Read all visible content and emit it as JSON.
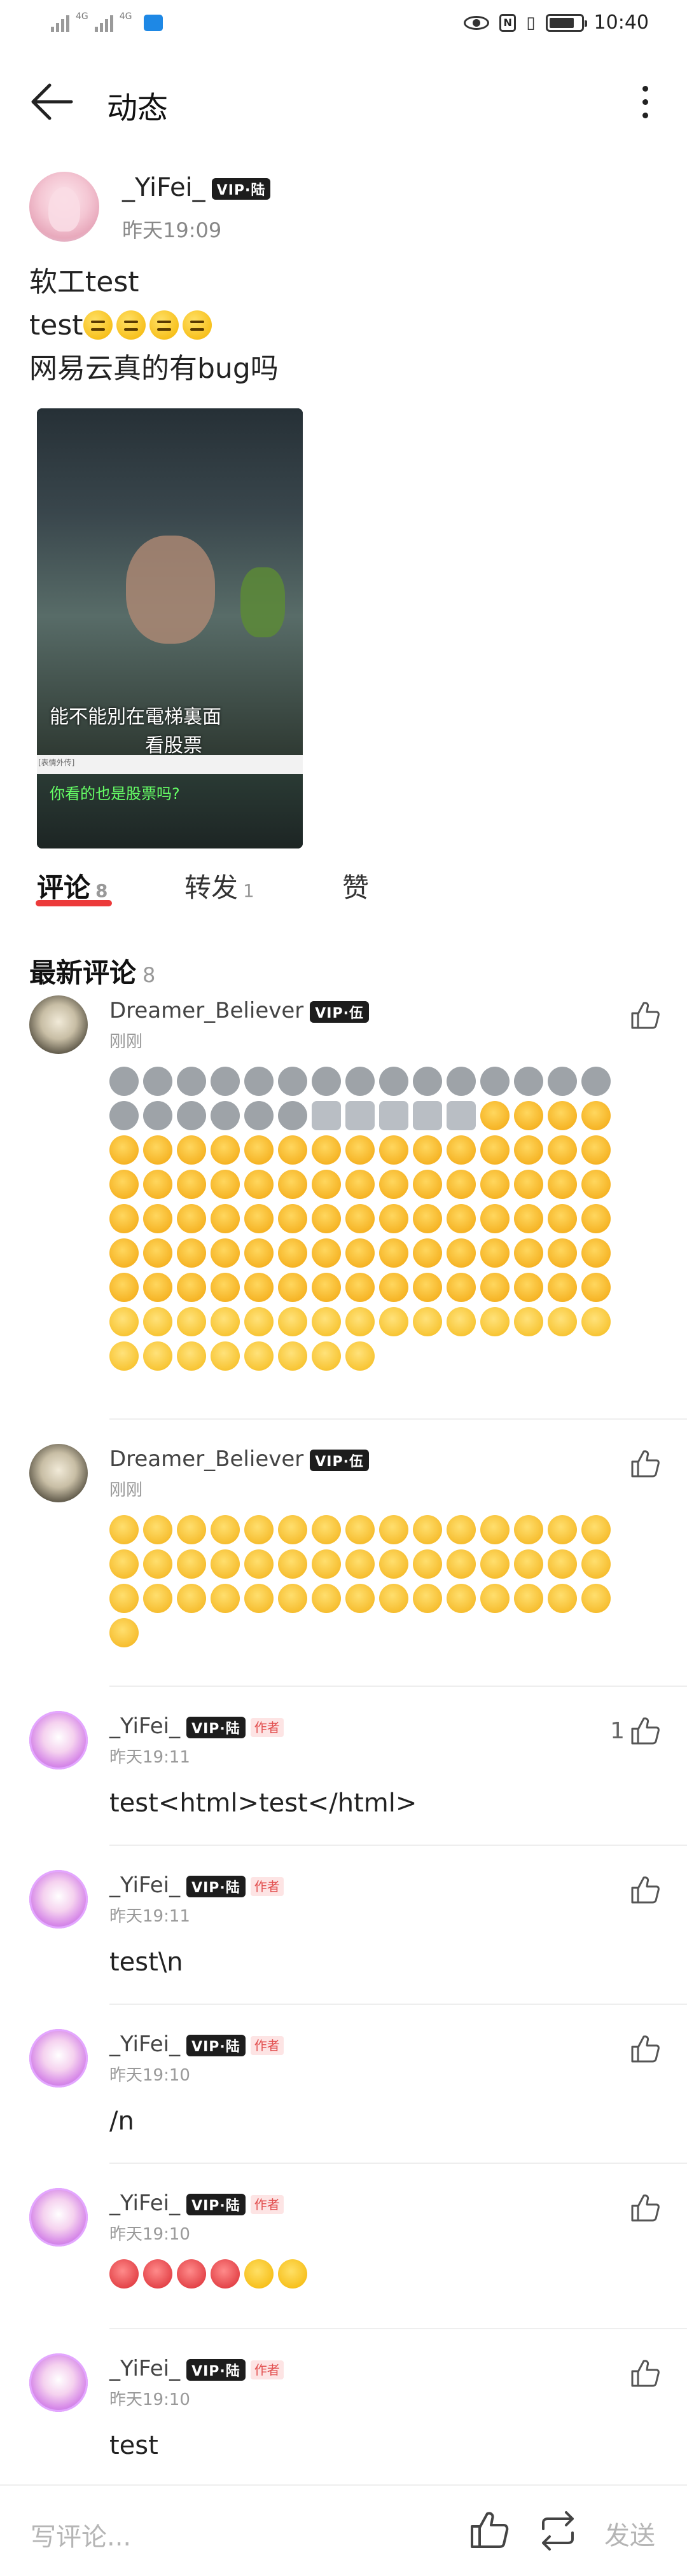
{
  "status_bar": {
    "signal1": "4G",
    "signal2": "4G",
    "time": "10:40"
  },
  "header": {
    "title": "动态"
  },
  "post": {
    "author": "_YiFei_",
    "vip_label": "VIP·陆",
    "time": "昨天19:09",
    "lines": [
      "软工test",
      "test",
      "网易云真的有bug吗"
    ],
    "think_emoji_count": 4,
    "image": {
      "subtitle_line1": "能不能別在電梯裏面",
      "subtitle_line2": "看股票",
      "small_tag": "[表情外传]",
      "caption": "你看的也是股票吗?"
    }
  },
  "tabs": [
    {
      "label": "评论",
      "count": "8"
    },
    {
      "label": "转发",
      "count": "1"
    },
    {
      "label": "赞",
      "count": ""
    }
  ],
  "section": {
    "title": "最新评论",
    "count": "8"
  },
  "comments": [
    {
      "name": "Dreamer_Believer",
      "vip": "VIP·伍",
      "time": "刚刚",
      "author_tag": "",
      "likes": "",
      "emojis": {
        "alien": 21,
        "robot": 5,
        "cat": 79,
        "sneeze": 23
      }
    },
    {
      "name": "Dreamer_Believer",
      "vip": "VIP·伍",
      "time": "刚刚",
      "author_tag": "",
      "likes": "",
      "emojis": {
        "unamused": 46
      }
    },
    {
      "name": "_YiFei_",
      "vip": "VIP·陆",
      "time": "昨天19:11",
      "author_tag": "作者",
      "likes": "1",
      "text": "test<html>test</html>"
    },
    {
      "name": "_YiFei_",
      "vip": "VIP·陆",
      "time": "昨天19:11",
      "author_tag": "作者",
      "likes": "",
      "text": "test\\n"
    },
    {
      "name": "_YiFei_",
      "vip": "VIP·陆",
      "time": "昨天19:10",
      "author_tag": "作者",
      "likes": "",
      "text": "/n"
    },
    {
      "name": "_YiFei_",
      "vip": "VIP·陆",
      "time": "昨天19:10",
      "author_tag": "作者",
      "likes": "",
      "emojis": {
        "devil": 4,
        "think": 2
      }
    },
    {
      "name": "_YiFei_",
      "vip": "VIP·陆",
      "time": "昨天19:10",
      "author_tag": "作者",
      "likes": "",
      "text": "test"
    }
  ],
  "emoji_glyphs": {
    "alien": "👽",
    "robot": "🤖",
    "cat": "😺",
    "sneeze": "🤧",
    "unamused": "😒",
    "devil": "👿",
    "think": "🤔"
  },
  "bottom_bar": {
    "placeholder": "写评论...",
    "send": "发送"
  },
  "colors": {
    "accent_red": "#ec3a3a",
    "vip_bg": "#1d1d1d",
    "author_tag_bg": "#fde4e4"
  }
}
